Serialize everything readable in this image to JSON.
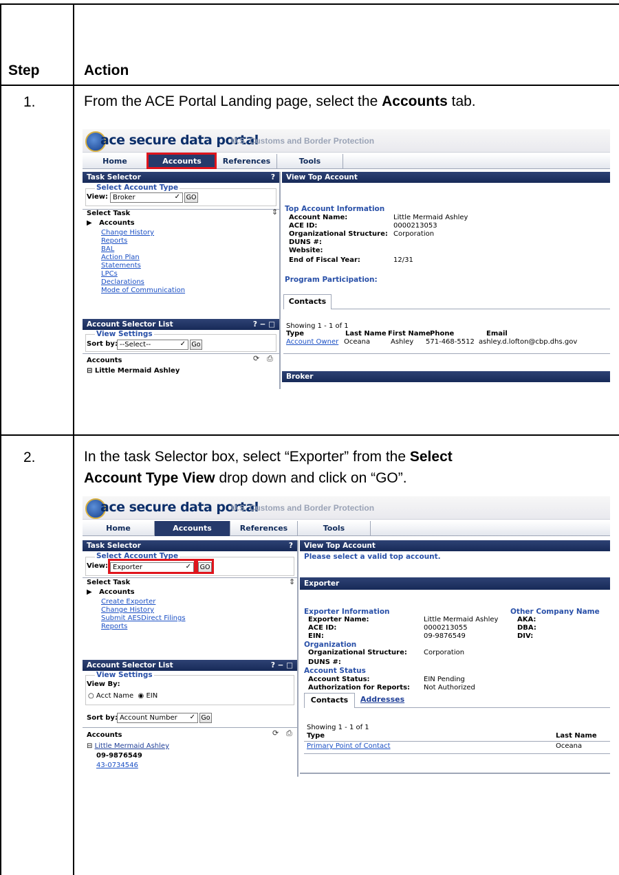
{
  "table": {
    "header_step": "Step",
    "header_action": "Action"
  },
  "step1": {
    "number": "1.",
    "text_pre": "From the ACE Portal Landing page, select the ",
    "text_bold": "Accounts",
    "text_post": " tab."
  },
  "step2": {
    "number": "2.",
    "line1_pre": "In the task Selector box, select “Exporter” from the ",
    "line1_bold": "Select",
    "line2_bold": "Account Type View",
    "line2_post": " drop down and click on “GO”."
  },
  "portal": {
    "logo_text": "ace secure data portal",
    "logo_sub": "U.S. Customs and Border Protection",
    "tabs": [
      "Home",
      "Accounts",
      "References",
      "Tools"
    ]
  },
  "shot1": {
    "task_selector": {
      "title": "Task Selector",
      "help": "?",
      "legend": "Select Account Type",
      "view_label": "View:",
      "view_value": "Broker",
      "go": "GO",
      "select_task": "Select Task",
      "accounts": "Accounts",
      "links": [
        "Change History",
        "Reports",
        "BAL",
        "Action Plan",
        "Statements",
        "LPCs",
        "Declarations",
        "Mode of Communication"
      ]
    },
    "account_selector": {
      "title": "Account Selector List",
      "controls": "? − □",
      "legend": "View Settings",
      "sort_label": "Sort by:",
      "sort_value": "--Select--",
      "go": "Go",
      "accounts_head": "Accounts",
      "tree_item": "⊟ Little Mermaid Ashley"
    },
    "top_account": {
      "title": "View Top Account",
      "section": "Top Account Information",
      "labels": [
        "Account Name:",
        "ACE ID:",
        "Organizational Structure:",
        "DUNS #:",
        "Website:",
        "End of Fiscal Year:"
      ],
      "values": [
        "Little Mermaid Ashley",
        "0000213053",
        "Corporation",
        "",
        "",
        "12/31"
      ],
      "program": "Program Participation:",
      "contacts_tab": "Contacts",
      "showing": "Showing 1 - 1 of 1",
      "cols": [
        "Type",
        "Last Name",
        "First Name",
        "Phone",
        "Email"
      ],
      "row_type": "Account Owner",
      "row": [
        "Oceana",
        "Ashley",
        "571-468-5512",
        "ashley.d.lofton@cbp.dhs.gov"
      ],
      "broker": "Broker"
    }
  },
  "shot2": {
    "task_selector": {
      "title": "Task Selector",
      "help": "?",
      "legend": "Select Account Type",
      "view_label": "View:",
      "view_value": "Exporter",
      "go": "GO",
      "select_task": "Select Task",
      "accounts": "Accounts",
      "links": [
        "Create Exporter",
        "Change History",
        "Submit AESDirect Filings",
        "Reports"
      ]
    },
    "account_selector": {
      "title": "Account Selector List",
      "controls": "? − □",
      "legend": "View Settings",
      "view_by": "View By:",
      "radio1": "Acct Name",
      "radio2": "EIN",
      "sort_label": "Sort by:",
      "sort_value": "Account Number",
      "go": "Go",
      "accounts_head": "Accounts",
      "tree_item": "Little Mermaid Ashley",
      "ein1": "09-9876549",
      "ein2": "43-0734546"
    },
    "top_account": {
      "title": "View Top Account",
      "message": "Please select a valid top account."
    },
    "exporter": {
      "title": "Exporter",
      "section": "Exporter Information",
      "labels": [
        "Exporter Name:",
        "ACE ID:",
        "EIN:"
      ],
      "values": [
        "Little Mermaid Ashley",
        "0000213055",
        "09-9876549"
      ],
      "other_title": "Other Company Name",
      "other_labels": [
        "AKA:",
        "DBA:",
        "DIV:"
      ],
      "org_section": "Organization",
      "org_labels": [
        "Organizational Structure:",
        "DUNS #:"
      ],
      "org_values": [
        "Corporation",
        ""
      ],
      "status_section": "Account Status",
      "status_labels": [
        "Account Status:",
        "Authorization for Reports:"
      ],
      "status_values": [
        "EIN Pending",
        "Not Authorized"
      ],
      "tab_contacts": "Contacts",
      "tab_addresses": "Addresses",
      "showing": "Showing 1 - 1 of 1",
      "col_type": "Type",
      "col_last": "Last Name",
      "row_type": "Primary Point of Contact",
      "row_last": "Oceana"
    }
  }
}
